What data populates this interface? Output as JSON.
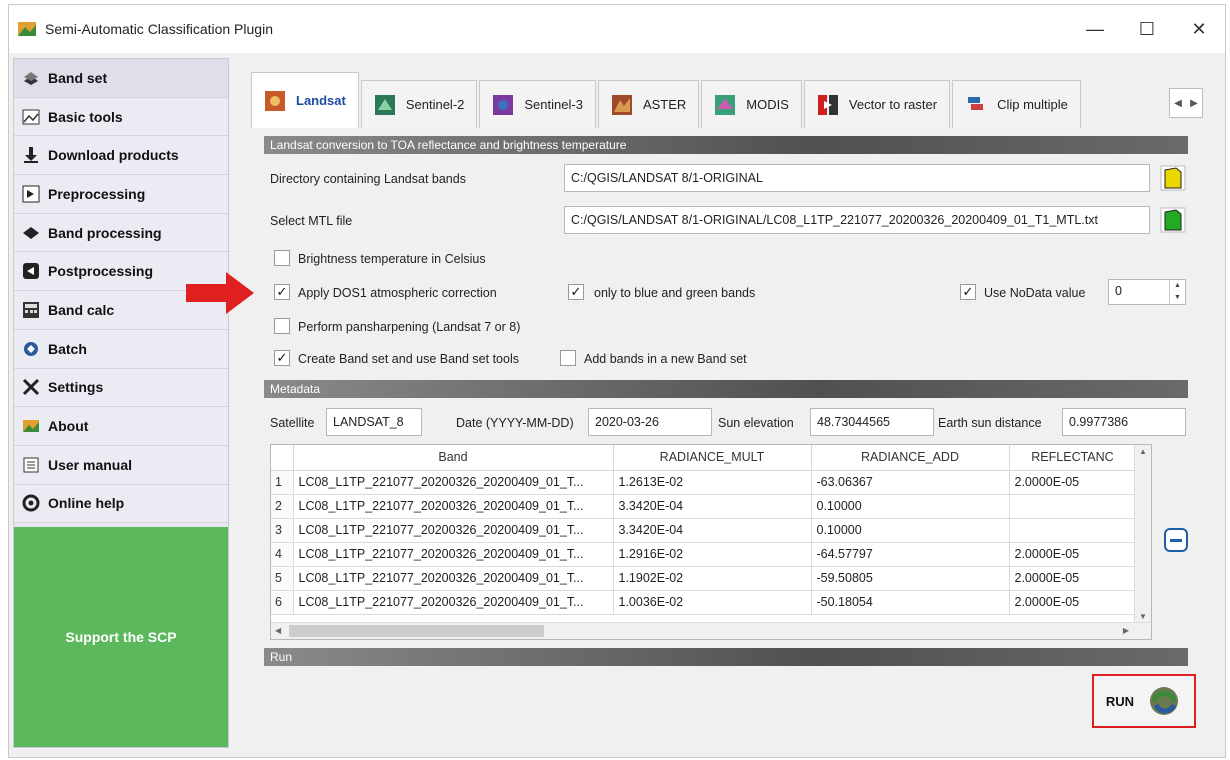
{
  "window": {
    "title": "Semi-Automatic Classification Plugin",
    "minimize": "—",
    "maximize": "☐",
    "close": "✕"
  },
  "sidebar": {
    "items": [
      {
        "label": "Band set",
        "icon": "band-set-icon"
      },
      {
        "label": "Basic tools",
        "icon": "basic-tools-icon"
      },
      {
        "label": "Download products",
        "icon": "download-icon"
      },
      {
        "label": "Preprocessing",
        "icon": "preprocessing-icon"
      },
      {
        "label": "Band processing",
        "icon": "band-processing-icon"
      },
      {
        "label": "Postprocessing",
        "icon": "postprocessing-icon"
      },
      {
        "label": "Band calc",
        "icon": "calculator-icon"
      },
      {
        "label": "Batch",
        "icon": "batch-icon"
      },
      {
        "label": "Settings",
        "icon": "settings-icon"
      },
      {
        "label": "About",
        "icon": "about-icon"
      },
      {
        "label": "User manual",
        "icon": "manual-icon"
      },
      {
        "label": "Online help",
        "icon": "help-icon"
      }
    ],
    "support": "Support the SCP"
  },
  "tabs": [
    {
      "label": "Landsat",
      "active": true
    },
    {
      "label": "Sentinel-2"
    },
    {
      "label": "Sentinel-3"
    },
    {
      "label": "ASTER"
    },
    {
      "label": "MODIS"
    },
    {
      "label": "Vector to raster"
    },
    {
      "label": "Clip multiple"
    }
  ],
  "landsat": {
    "section_title": "Landsat conversion to TOA reflectance and brightness temperature",
    "dir_label": "Directory containing Landsat bands",
    "dir_value": "C:/QGIS/LANDSAT 8/1-ORIGINAL",
    "mtl_label": "Select MTL file",
    "mtl_value": "C:/QGIS/LANDSAT 8/1-ORIGINAL/LC08_L1TP_221077_20200326_20200409_01_T1_MTL.txt",
    "brightness_celsius": {
      "label": "Brightness temperature in Celsius",
      "checked": false
    },
    "dos1": {
      "label": "Apply DOS1 atmospheric correction",
      "checked": true
    },
    "blue_green": {
      "label": "only to blue and green bands",
      "checked": true
    },
    "nodata": {
      "label": "Use NoData value",
      "checked": true,
      "value": "0"
    },
    "pansharpen": {
      "label": "Perform pansharpening (Landsat 7 or 8)",
      "checked": false
    },
    "create_bandset": {
      "label": "Create Band set and use Band set tools",
      "checked": true
    },
    "add_bands": {
      "label": "Add bands in a new Band set",
      "checked": false
    }
  },
  "metadata": {
    "section_title": "Metadata",
    "satellite_label": "Satellite",
    "satellite_value": "LANDSAT_8",
    "date_label": "Date (YYYY-MM-DD)",
    "date_value": "2020-03-26",
    "sun_label": "Sun elevation",
    "sun_value": "48.73044565",
    "earth_label": "Earth sun distance",
    "earth_value": "0.9977386",
    "columns": [
      "Band",
      "RADIANCE_MULT",
      "RADIANCE_ADD",
      "REFLECTANC"
    ],
    "rows": [
      [
        "1",
        "LC08_L1TP_221077_20200326_20200409_01_T...",
        "1.2613E-02",
        "-63.06367",
        "2.0000E-05"
      ],
      [
        "2",
        "LC08_L1TP_221077_20200326_20200409_01_T...",
        "3.3420E-04",
        "0.10000",
        ""
      ],
      [
        "3",
        "LC08_L1TP_221077_20200326_20200409_01_T...",
        "3.3420E-04",
        "0.10000",
        ""
      ],
      [
        "4",
        "LC08_L1TP_221077_20200326_20200409_01_T...",
        "1.2916E-02",
        "-64.57797",
        "2.0000E-05"
      ],
      [
        "5",
        "LC08_L1TP_221077_20200326_20200409_01_T...",
        "1.1902E-02",
        "-59.50805",
        "2.0000E-05"
      ],
      [
        "6",
        "LC08_L1TP_221077_20200326_20200409_01_T...",
        "1.0036E-02",
        "-50.18054",
        "2.0000E-05"
      ]
    ]
  },
  "run": {
    "section_title": "Run",
    "button_label": "RUN"
  },
  "colors": {
    "support_green": "#5cb85c",
    "annotation_red": "#e02020",
    "accent_blue": "#1f5fa8"
  }
}
